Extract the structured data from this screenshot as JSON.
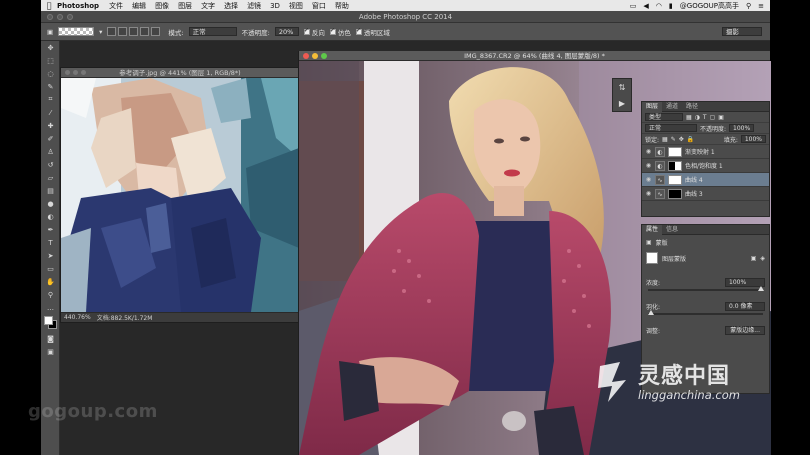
{
  "menubar": {
    "app_name": "Photoshop",
    "menus": [
      "文件",
      "编辑",
      "图像",
      "图层",
      "文字",
      "选择",
      "滤镜",
      "3D",
      "视图",
      "窗口",
      "帮助"
    ],
    "user": "@GOGOUP高高手"
  },
  "app_title": "Adobe Photoshop CC 2014",
  "options_bar": {
    "mode_label": "模式:",
    "mode_value": "正常",
    "opacity_label": "不透明度:",
    "opacity_value": "20%",
    "reverse_label": "反向",
    "dither_label": "仿色",
    "transparency_label": "透明区域",
    "workspace_value": "摄影"
  },
  "doc1": {
    "title": "参考调子.jpg @ 441% (图层 1, RGB/8*)",
    "zoom": "440.76%",
    "file_info": "文档:882.5K/1.72M"
  },
  "doc2": {
    "title": "IMG_8367.CR2 @ 64% (曲线 4, 图层蒙版/8) *"
  },
  "layers_panel": {
    "tabs": [
      "图层",
      "通道",
      "路径"
    ],
    "kind_label": "类型",
    "blend_mode": "正常",
    "opacity_label": "不透明度:",
    "opacity_value": "100%",
    "lock_label": "锁定:",
    "fill_label": "填充:",
    "fill_value": "100%",
    "layers": [
      {
        "name": "渐变映射 1"
      },
      {
        "name": "色相/饱和度 1"
      },
      {
        "name": "曲线 4"
      },
      {
        "name": "曲线 3"
      }
    ]
  },
  "properties_panel": {
    "tabs": [
      "属性",
      "信息"
    ],
    "mask_label": "蒙版",
    "layer_mask_label": "图层蒙版",
    "density_label": "浓度:",
    "density_value": "100%",
    "feather_label": "羽化:",
    "feather_value": "0.0 像素",
    "refine_label": "调整:",
    "mask_edge_button": "蒙版边缘..."
  },
  "watermark": {
    "title": "灵感中国",
    "url": "lingganchina.com",
    "gogoup": "gogoup.com"
  },
  "colors": {
    "menubar": "#e8e8e8",
    "panel": "#4b4b4b",
    "layer_selected": "#6b7d90",
    "close_dot": "#ee5b52",
    "min_dot": "#f4bd38",
    "max_dot": "#5fc84a"
  }
}
